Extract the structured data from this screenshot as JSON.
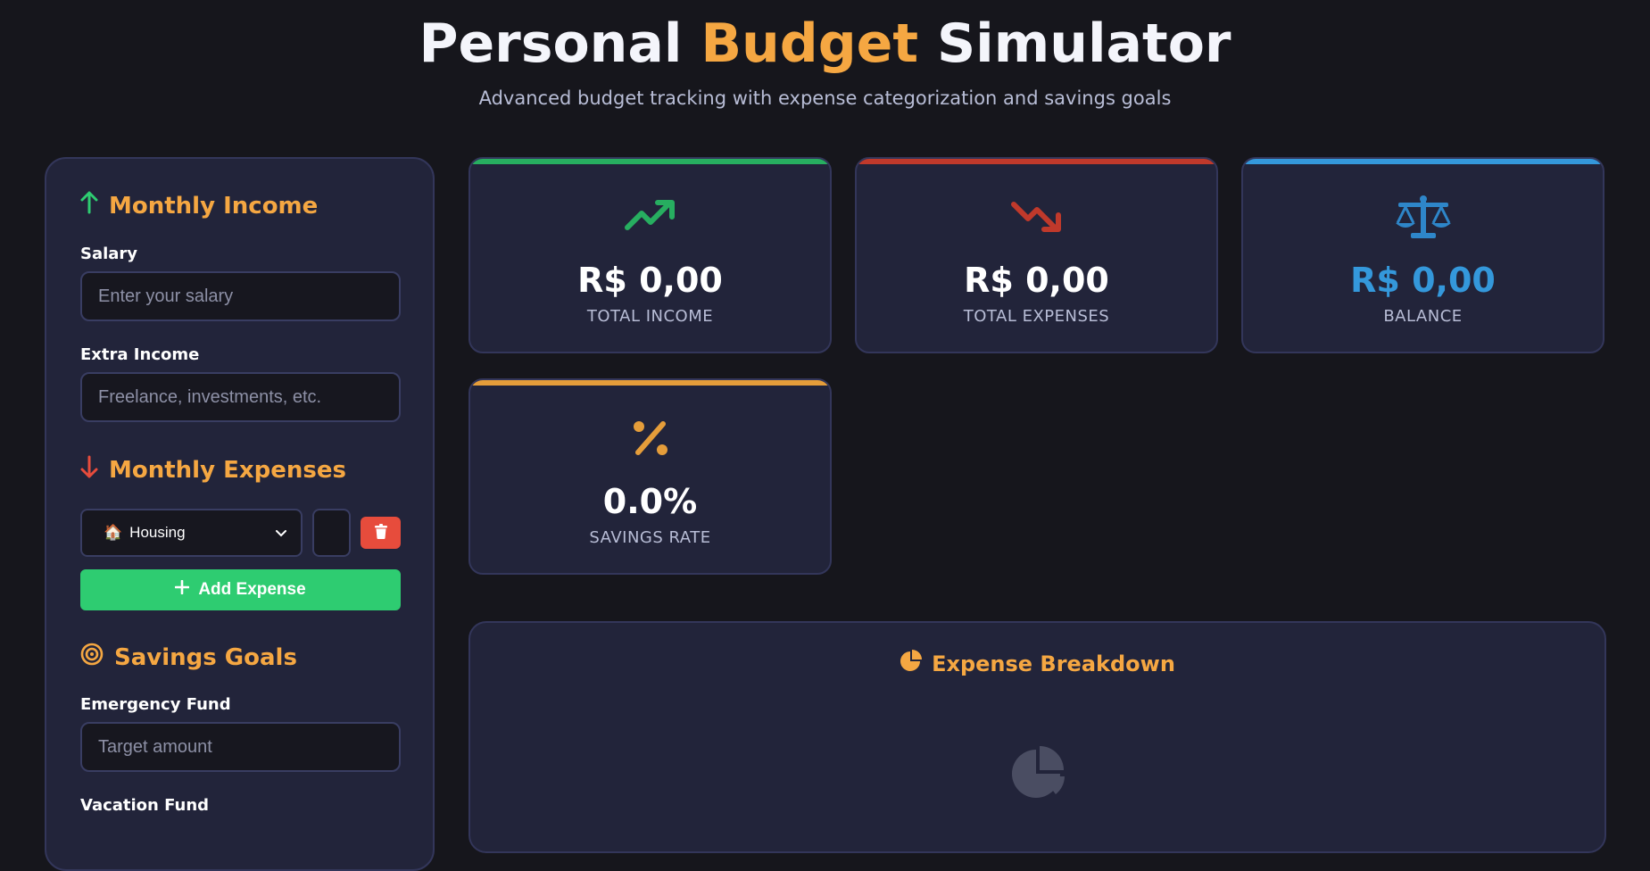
{
  "header": {
    "title_part1": "Personal ",
    "title_accent": "Budget",
    "title_part2": " Simulator",
    "subtitle": "Advanced budget tracking with expense categorization and savings goals"
  },
  "sidebar": {
    "income": {
      "title": "Monthly Income",
      "icon": "arrow-up-icon",
      "salary_label": "Salary",
      "salary_placeholder": "Enter your salary",
      "extra_label": "Extra Income",
      "extra_placeholder": "Freelance, investments, etc."
    },
    "expenses": {
      "title": "Monthly Expenses",
      "icon": "arrow-down-icon",
      "category_selected": "Housing",
      "category_emoji": "🏠",
      "add_label": "Add Expense"
    },
    "savings": {
      "title": "Savings Goals",
      "icon": "bullseye-icon",
      "emergency_label": "Emergency Fund",
      "emergency_placeholder": "Target amount",
      "vacation_label": "Vacation Fund"
    }
  },
  "stats": [
    {
      "value": "R$ 0,00",
      "label": "TOTAL INCOME",
      "color": "#27ae60",
      "value_color": "#ffffff",
      "icon": "trend-up-icon"
    },
    {
      "value": "R$ 0,00",
      "label": "TOTAL EXPENSES",
      "color": "#c0392b",
      "value_color": "#ffffff",
      "icon": "trend-down-icon"
    },
    {
      "value": "R$ 0,00",
      "label": "BALANCE",
      "color": "#3498db",
      "value_color": "#3498db",
      "icon": "scale-balance-icon"
    },
    {
      "value": "0.0%",
      "label": "SAVINGS RATE",
      "color": "#e59d3a",
      "value_color": "#ffffff",
      "icon": "percent-icon"
    }
  ],
  "breakdown": {
    "title": "Expense Breakdown",
    "icon": "pie-chart-icon"
  },
  "colors": {
    "accent": "#f5a742",
    "income": "#27ae60",
    "expense": "#e74c3c",
    "balance": "#3498db",
    "add_button": "#2ecc71"
  }
}
